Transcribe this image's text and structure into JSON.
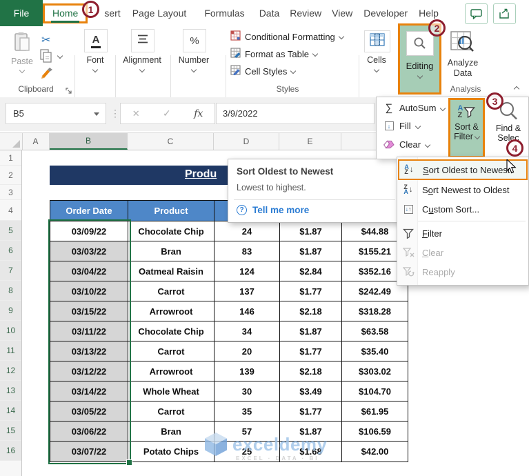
{
  "colors": {
    "excel_green": "#217346",
    "callout_red": "#8E1E2E",
    "highlight_orange": "#E8820C",
    "editing_green": "#A6CDB6",
    "title_navy": "#1F3864",
    "header_blue": "#4E87C8",
    "selection_gray": "#D6D6D6"
  },
  "icons": {
    "scissors": "✂",
    "sigma": "∑",
    "percent": "%",
    "check": "✓",
    "cancel": "✕",
    "down_arrow": "↓",
    "up_arrow": "↑",
    "ellipsis": "⋮",
    "font_a": "A",
    "question": "?"
  },
  "ribbon": {
    "file_tab": "File",
    "tabs": [
      "Home",
      "sert",
      "Page Layout",
      "Formulas",
      "Data",
      "Review",
      "View",
      "Developer",
      "Help"
    ],
    "active_tab": "Home",
    "paste_label": "Paste",
    "clipboard_label": "Clipboard",
    "font_label": "Font",
    "alignment_label": "Alignment",
    "number_label": "Number",
    "styles_items": [
      "Conditional Formatting",
      "Format as Table",
      "Cell Styles"
    ],
    "styles_label": "Styles",
    "cells_label": "Cells",
    "editing_label": "Editing",
    "analyze_line1": "Analyze",
    "analyze_line2": "Data",
    "analysis_label": "Analysis"
  },
  "formula_bar": {
    "name_box": "B5",
    "fx": "fx",
    "value": "3/9/2022"
  },
  "sheet": {
    "columns": [
      "A",
      "B",
      "C",
      "D",
      "E"
    ],
    "selected_column": "B",
    "row_numbers": [
      "1",
      "2",
      "3",
      "4",
      "5",
      "6",
      "7",
      "8",
      "9",
      "10",
      "11",
      "12",
      "13",
      "14",
      "15",
      "16"
    ],
    "title": "Produ"
  },
  "table": {
    "headers": [
      "Order Date",
      "Product",
      "",
      "",
      ""
    ],
    "rows": [
      [
        "03/09/22",
        "Chocolate Chip",
        "24",
        "$1.87",
        "$44.88"
      ],
      [
        "03/03/22",
        "Bran",
        "83",
        "$1.87",
        "$155.21"
      ],
      [
        "03/04/22",
        "Oatmeal Raisin",
        "124",
        "$2.84",
        "$352.16"
      ],
      [
        "03/10/22",
        "Carrot",
        "137",
        "$1.77",
        "$242.49"
      ],
      [
        "03/15/22",
        "Arrowroot",
        "146",
        "$2.18",
        "$318.28"
      ],
      [
        "03/11/22",
        "Chocolate Chip",
        "34",
        "$1.87",
        "$63.58"
      ],
      [
        "03/13/22",
        "Carrot",
        "20",
        "$1.77",
        "$35.40"
      ],
      [
        "03/12/22",
        "Arrowroot",
        "139",
        "$2.18",
        "$303.02"
      ],
      [
        "03/14/22",
        "Whole Wheat",
        "30",
        "$3.49",
        "$104.70"
      ],
      [
        "03/05/22",
        "Carrot",
        "35",
        "$1.77",
        "$61.95"
      ],
      [
        "03/06/22",
        "Bran",
        "57",
        "$1.87",
        "$106.59"
      ],
      [
        "03/07/22",
        "Potato Chips",
        "25",
        "$1.68",
        "$42.00"
      ]
    ]
  },
  "tooltip": {
    "title": "Sort Oldest to Newest",
    "subtitle": "Lowest to highest.",
    "link": "Tell me more"
  },
  "editing_menu": {
    "autosum": "AutoSum",
    "fill": "Fill",
    "clear": "Clear",
    "sort_line1": "Sort &",
    "sort_line2": "Filter",
    "find_line1": "Find &",
    "find_line2": "Selec"
  },
  "sort_menu": {
    "items": [
      {
        "label": "Sort Oldest to Newest",
        "underline": 0,
        "icon": "az",
        "highlight": true,
        "disabled": false
      },
      {
        "label": "Sort Newest to Oldest",
        "underline": 1,
        "icon": "za",
        "highlight": false,
        "disabled": false
      },
      {
        "label": "Custom Sort...",
        "underline": 1,
        "icon": "custom",
        "highlight": false,
        "disabled": false,
        "separator_after": true
      },
      {
        "label": "Filter",
        "underline": 0,
        "icon": "filter",
        "highlight": false,
        "disabled": false
      },
      {
        "label": "Clear",
        "underline": 0,
        "icon": "clear",
        "highlight": false,
        "disabled": true
      },
      {
        "label": "Reapply",
        "underline": -1,
        "icon": "reapply",
        "highlight": false,
        "disabled": true
      }
    ]
  },
  "callouts": [
    "1",
    "2",
    "3",
    "4"
  ],
  "watermark": {
    "text": "exceldemy",
    "subtext": "EXCEL · DATA · BI"
  }
}
